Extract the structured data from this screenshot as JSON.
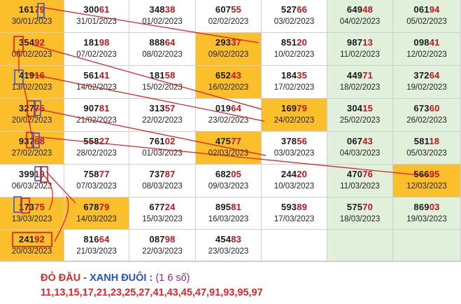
{
  "grid": {
    "rows": [
      [
        {
          "num": "16179",
          "date": "30/01/2023",
          "bg": "orange"
        },
        {
          "num": "30061",
          "date": "31/01/2023",
          "bg": "white"
        },
        {
          "num": "34838",
          "date": "01/02/2023",
          "bg": "white"
        },
        {
          "num": "60755",
          "date": "02/02/2023",
          "bg": "white"
        },
        {
          "num": "52766",
          "date": "03/02/2023",
          "bg": "white"
        },
        {
          "num": "64948",
          "date": "04/02/2023",
          "bg": "green"
        },
        {
          "num": "06194",
          "date": "05/02/2023",
          "bg": "green"
        }
      ],
      [
        {
          "num": "35492",
          "date": "06/02/2023",
          "bg": "orange"
        },
        {
          "num": "18198",
          "date": "07/02/2023",
          "bg": "white"
        },
        {
          "num": "88864",
          "date": "08/02/2023",
          "bg": "white"
        },
        {
          "num": "29337",
          "date": "09/02/2023",
          "bg": "orange"
        },
        {
          "num": "85120",
          "date": "10/02/2023",
          "bg": "white"
        },
        {
          "num": "98713",
          "date": "11/02/2023",
          "bg": "green"
        },
        {
          "num": "09841",
          "date": "12/02/2023",
          "bg": "green"
        }
      ],
      [
        {
          "num": "41916",
          "date": "13/02/2023",
          "bg": "orange"
        },
        {
          "num": "56141",
          "date": "14/02/2023",
          "bg": "white"
        },
        {
          "num": "18158",
          "date": "15/02/2023",
          "bg": "white"
        },
        {
          "num": "65243",
          "date": "16/02/2023",
          "bg": "orange"
        },
        {
          "num": "18435",
          "date": "17/02/2023",
          "bg": "white"
        },
        {
          "num": "44971",
          "date": "18/02/2023",
          "bg": "green"
        },
        {
          "num": "37264",
          "date": "19/02/2023",
          "bg": "green"
        }
      ],
      [
        {
          "num": "32775",
          "date": "20/02/2023",
          "bg": "orange"
        },
        {
          "num": "90781",
          "date": "21/02/2023",
          "bg": "white"
        },
        {
          "num": "31357",
          "date": "22/02/2023",
          "bg": "white"
        },
        {
          "num": "01964",
          "date": "23/02/2023",
          "bg": "white"
        },
        {
          "num": "16979",
          "date": "24/02/2023",
          "bg": "orange"
        },
        {
          "num": "30415",
          "date": "25/02/2023",
          "bg": "green"
        },
        {
          "num": "67360",
          "date": "26/02/2023",
          "bg": "green"
        }
      ],
      [
        {
          "num": "93768",
          "date": "27/02/2023",
          "bg": "orange"
        },
        {
          "num": "55827",
          "date": "28/02/2023",
          "bg": "white"
        },
        {
          "num": "76102",
          "date": "01/03/2023",
          "bg": "white"
        },
        {
          "num": "47577",
          "date": "02/03/2023",
          "bg": "orange"
        },
        {
          "num": "37856",
          "date": "03/03/2023",
          "bg": "white"
        },
        {
          "num": "06743",
          "date": "04/03/2023",
          "bg": "green"
        },
        {
          "num": "58118",
          "date": "05/03/2023",
          "bg": "green"
        }
      ],
      [
        {
          "num": "39919",
          "date": "06/03/2023",
          "bg": "white"
        },
        {
          "num": "75877",
          "date": "07/03/2023",
          "bg": "white"
        },
        {
          "num": "73787",
          "date": "08/03/2023",
          "bg": "white"
        },
        {
          "num": "68205",
          "date": "09/03/2023",
          "bg": "white"
        },
        {
          "num": "24420",
          "date": "10/03/2023",
          "bg": "white"
        },
        {
          "num": "47076",
          "date": "11/03/2023",
          "bg": "green"
        },
        {
          "num": "56695",
          "date": "12/03/2023",
          "bg": "orange"
        }
      ],
      [
        {
          "num": "17375",
          "date": "13/03/2023",
          "bg": "orange"
        },
        {
          "num": "67879",
          "date": "14/03/2023",
          "bg": "orange"
        },
        {
          "num": "67724",
          "date": "15/03/2023",
          "bg": "white"
        },
        {
          "num": "89581",
          "date": "16/03/2023",
          "bg": "white"
        },
        {
          "num": "59389",
          "date": "17/03/2023",
          "bg": "white"
        },
        {
          "num": "57570",
          "date": "18/03/2023",
          "bg": "green"
        },
        {
          "num": "86903",
          "date": "19/03/2023",
          "bg": "green"
        }
      ],
      [
        {
          "num": "24192",
          "date": "20/03/2023",
          "bg": "orange"
        },
        {
          "num": "81664",
          "date": "21/03/2023",
          "bg": "white"
        },
        {
          "num": "08798",
          "date": "22/03/2023",
          "bg": "white"
        },
        {
          "num": "45483",
          "date": "23/03/2023",
          "bg": "white"
        },
        {
          "num": "",
          "date": "",
          "bg": "white"
        },
        {
          "num": "",
          "date": "",
          "bg": "green"
        },
        {
          "num": "",
          "date": "",
          "bg": "green"
        }
      ]
    ]
  },
  "caption": {
    "part_red": "ĐỎ ĐẦU",
    "separator": " - ",
    "part_blue": "XANH ĐUÔI :",
    "count": " (1 6 số)",
    "numbers": "11,13,15,17,21,23,25,27,41,43,45,47,91,93,95,97"
  },
  "colors": {
    "orange": "#fcbf2c",
    "green": "#e0f0da",
    "digit_red": "#c0161c",
    "caption_red": "#e0262b",
    "caption_blue": "#2554c7",
    "marker_red": "#e3161c",
    "marker_blue": "#3a56c9"
  }
}
